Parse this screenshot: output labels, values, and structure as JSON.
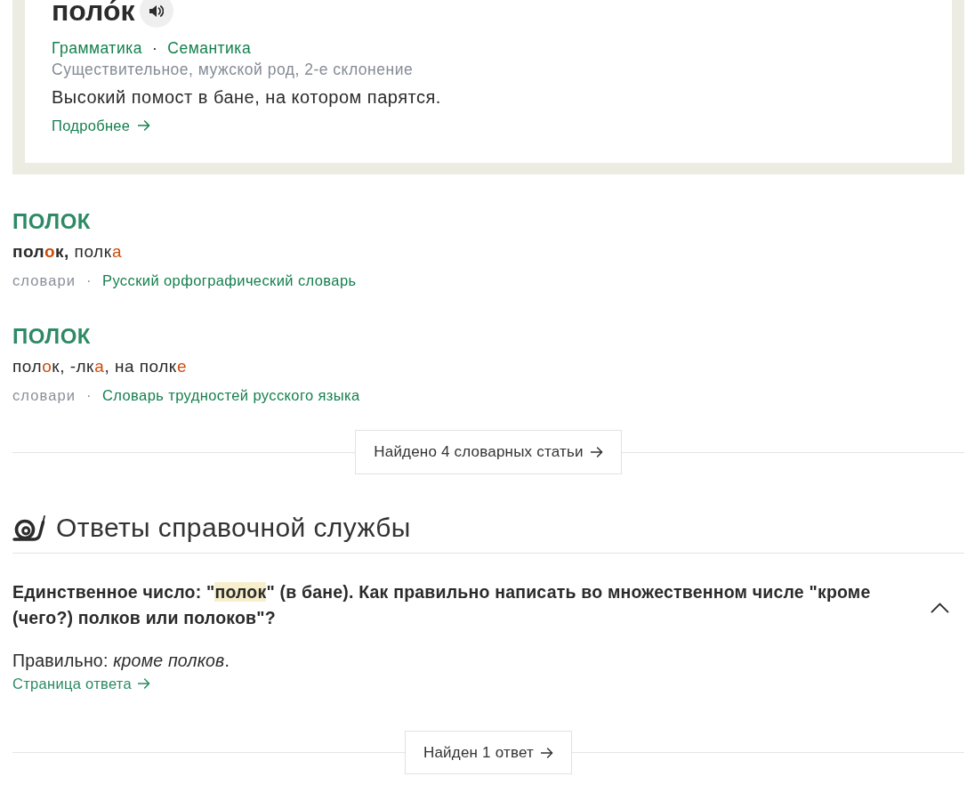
{
  "word_card": {
    "title": "поло́к",
    "links": [
      "Грамматика",
      "Семантика"
    ],
    "separator": "·",
    "grammar": "Существительное, мужской род, 2-е склонение",
    "definition": "Высокий помост в бане, на котором парятся.",
    "more_link": "Подробнее"
  },
  "entries": [
    {
      "heading": "ПОЛОК",
      "form": [
        {
          "text": "пол",
          "bold": true,
          "stressed": false
        },
        {
          "text": "о",
          "bold": true,
          "stressed": true
        },
        {
          "text": "к,",
          "bold": true,
          "stressed": false
        },
        {
          "text": " полк",
          "bold": false,
          "stressed": false
        },
        {
          "text": "а",
          "bold": false,
          "stressed": true
        }
      ],
      "source_label": "словари",
      "separator": "·",
      "source": "Русский орфографический словарь"
    },
    {
      "heading": "ПОЛОК",
      "form": [
        {
          "text": "пол",
          "bold": false,
          "stressed": false
        },
        {
          "text": "о",
          "bold": false,
          "stressed": true
        },
        {
          "text": "к, -лк",
          "bold": false,
          "stressed": false
        },
        {
          "text": "а",
          "bold": false,
          "stressed": true
        },
        {
          "text": ", на полк",
          "bold": false,
          "stressed": false
        },
        {
          "text": "е",
          "bold": false,
          "stressed": true
        }
      ],
      "source_label": "словари",
      "separator": "·",
      "source": "Словарь трудностей русского языка"
    }
  ],
  "entries_button": "Найдено 4 словарных статьи",
  "help_section": {
    "title": "Ответы справочной службы",
    "questions": [
      {
        "question": [
          {
            "text": "Единственное число: \"",
            "highlighted": false
          },
          {
            "text": "полок",
            "highlighted": true
          },
          {
            "text": "\" (в бане). Как правильно написать во множественном числе \"кроме (чего?) полков или полоков\"?",
            "highlighted": false
          }
        ],
        "expanded": true,
        "answer": "Правильно: *кроме полков*.",
        "answer_link": "Страница ответа"
      }
    ],
    "more_button": "Найден 1 ответ"
  }
}
